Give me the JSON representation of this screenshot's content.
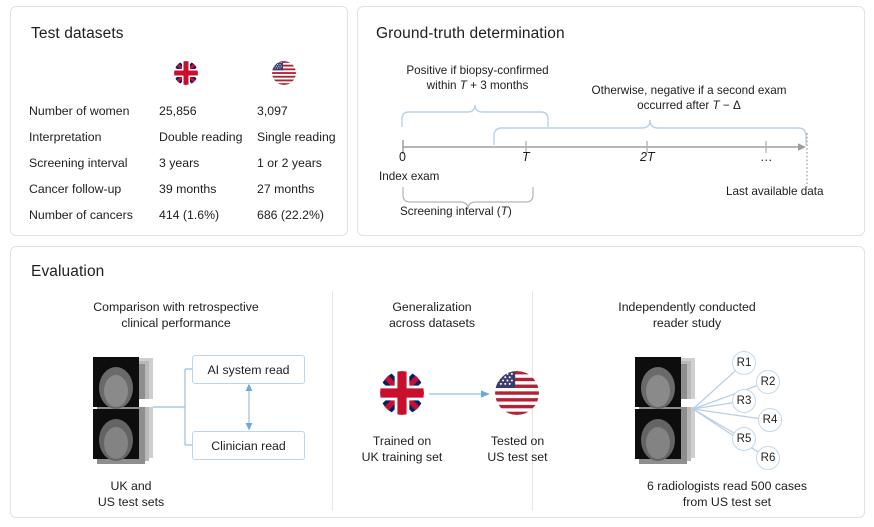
{
  "panels": {
    "datasets": {
      "title": "Test datasets",
      "columns": [
        "uk-flag-icon",
        "us-flag-icon"
      ],
      "rows": [
        {
          "label": "Number of women",
          "uk": "25,856",
          "us": "3,097"
        },
        {
          "label": "Interpretation",
          "uk": "Double reading",
          "us": "Single reading"
        },
        {
          "label": "Screening interval",
          "uk": "3 years",
          "us": "1 or 2 years"
        },
        {
          "label": "Cancer follow-up",
          "uk": "39 months",
          "us": "27 months"
        },
        {
          "label": "Number of cancers",
          "uk": "414 (1.6%)",
          "us": "686 (22.2%)"
        }
      ]
    },
    "ground_truth": {
      "title": "Ground-truth determination",
      "note_positive_line1": "Positive if biopsy-confirmed",
      "note_positive_line2_pre": "within ",
      "note_positive_line2_var": "T",
      "note_positive_line2_post": " + 3 months",
      "note_negative_line1": "Otherwise, negative if a second exam",
      "note_negative_line2_pre": "occurred after ",
      "note_negative_line2_var": "T",
      "note_negative_line2_post": " − Δ",
      "ticks": [
        {
          "label": "0",
          "italic": false
        },
        {
          "label": "T",
          "italic": true
        },
        {
          "label": "2T",
          "italic": true
        },
        {
          "label": "…",
          "italic": false
        }
      ],
      "index_exam_label": "Index exam",
      "last_data_label": "Last available data",
      "screening_interval_pre": "Screening interval (",
      "screening_interval_var": "T",
      "screening_interval_post": ")"
    },
    "evaluation": {
      "title": "Evaluation",
      "sections": [
        {
          "heading_line1": "Comparison with retrospective",
          "heading_line2": "clinical performance",
          "box_ai": "AI system read",
          "box_clinician": "Clinician read",
          "caption_line1": "UK and",
          "caption_line2": "US test sets"
        },
        {
          "heading_line1": "Generalization",
          "heading_line2": "across datasets",
          "caption_left_line1": "Trained on",
          "caption_left_line2": "UK training set",
          "caption_right_line1": "Tested on",
          "caption_right_line2": "US test set"
        },
        {
          "heading_line1": "Independently conducted",
          "heading_line2": "reader study",
          "readers": [
            "R1",
            "R2",
            "R3",
            "R4",
            "R5",
            "R6"
          ],
          "caption_line1": "6 radiologists read 500 cases",
          "caption_line2": "from US test set"
        }
      ]
    }
  },
  "colors": {
    "panel_border": "#e2e2e2",
    "text": "#1d1d1d",
    "accent_blue": "#a8c8e8",
    "box_border": "#bcd6ee",
    "axis_gray": "#9a9a9a",
    "uk_flag_red": "#c8102e",
    "uk_flag_blue": "#012169",
    "us_flag_red": "#b22234",
    "us_flag_blue": "#3c3b6e"
  }
}
